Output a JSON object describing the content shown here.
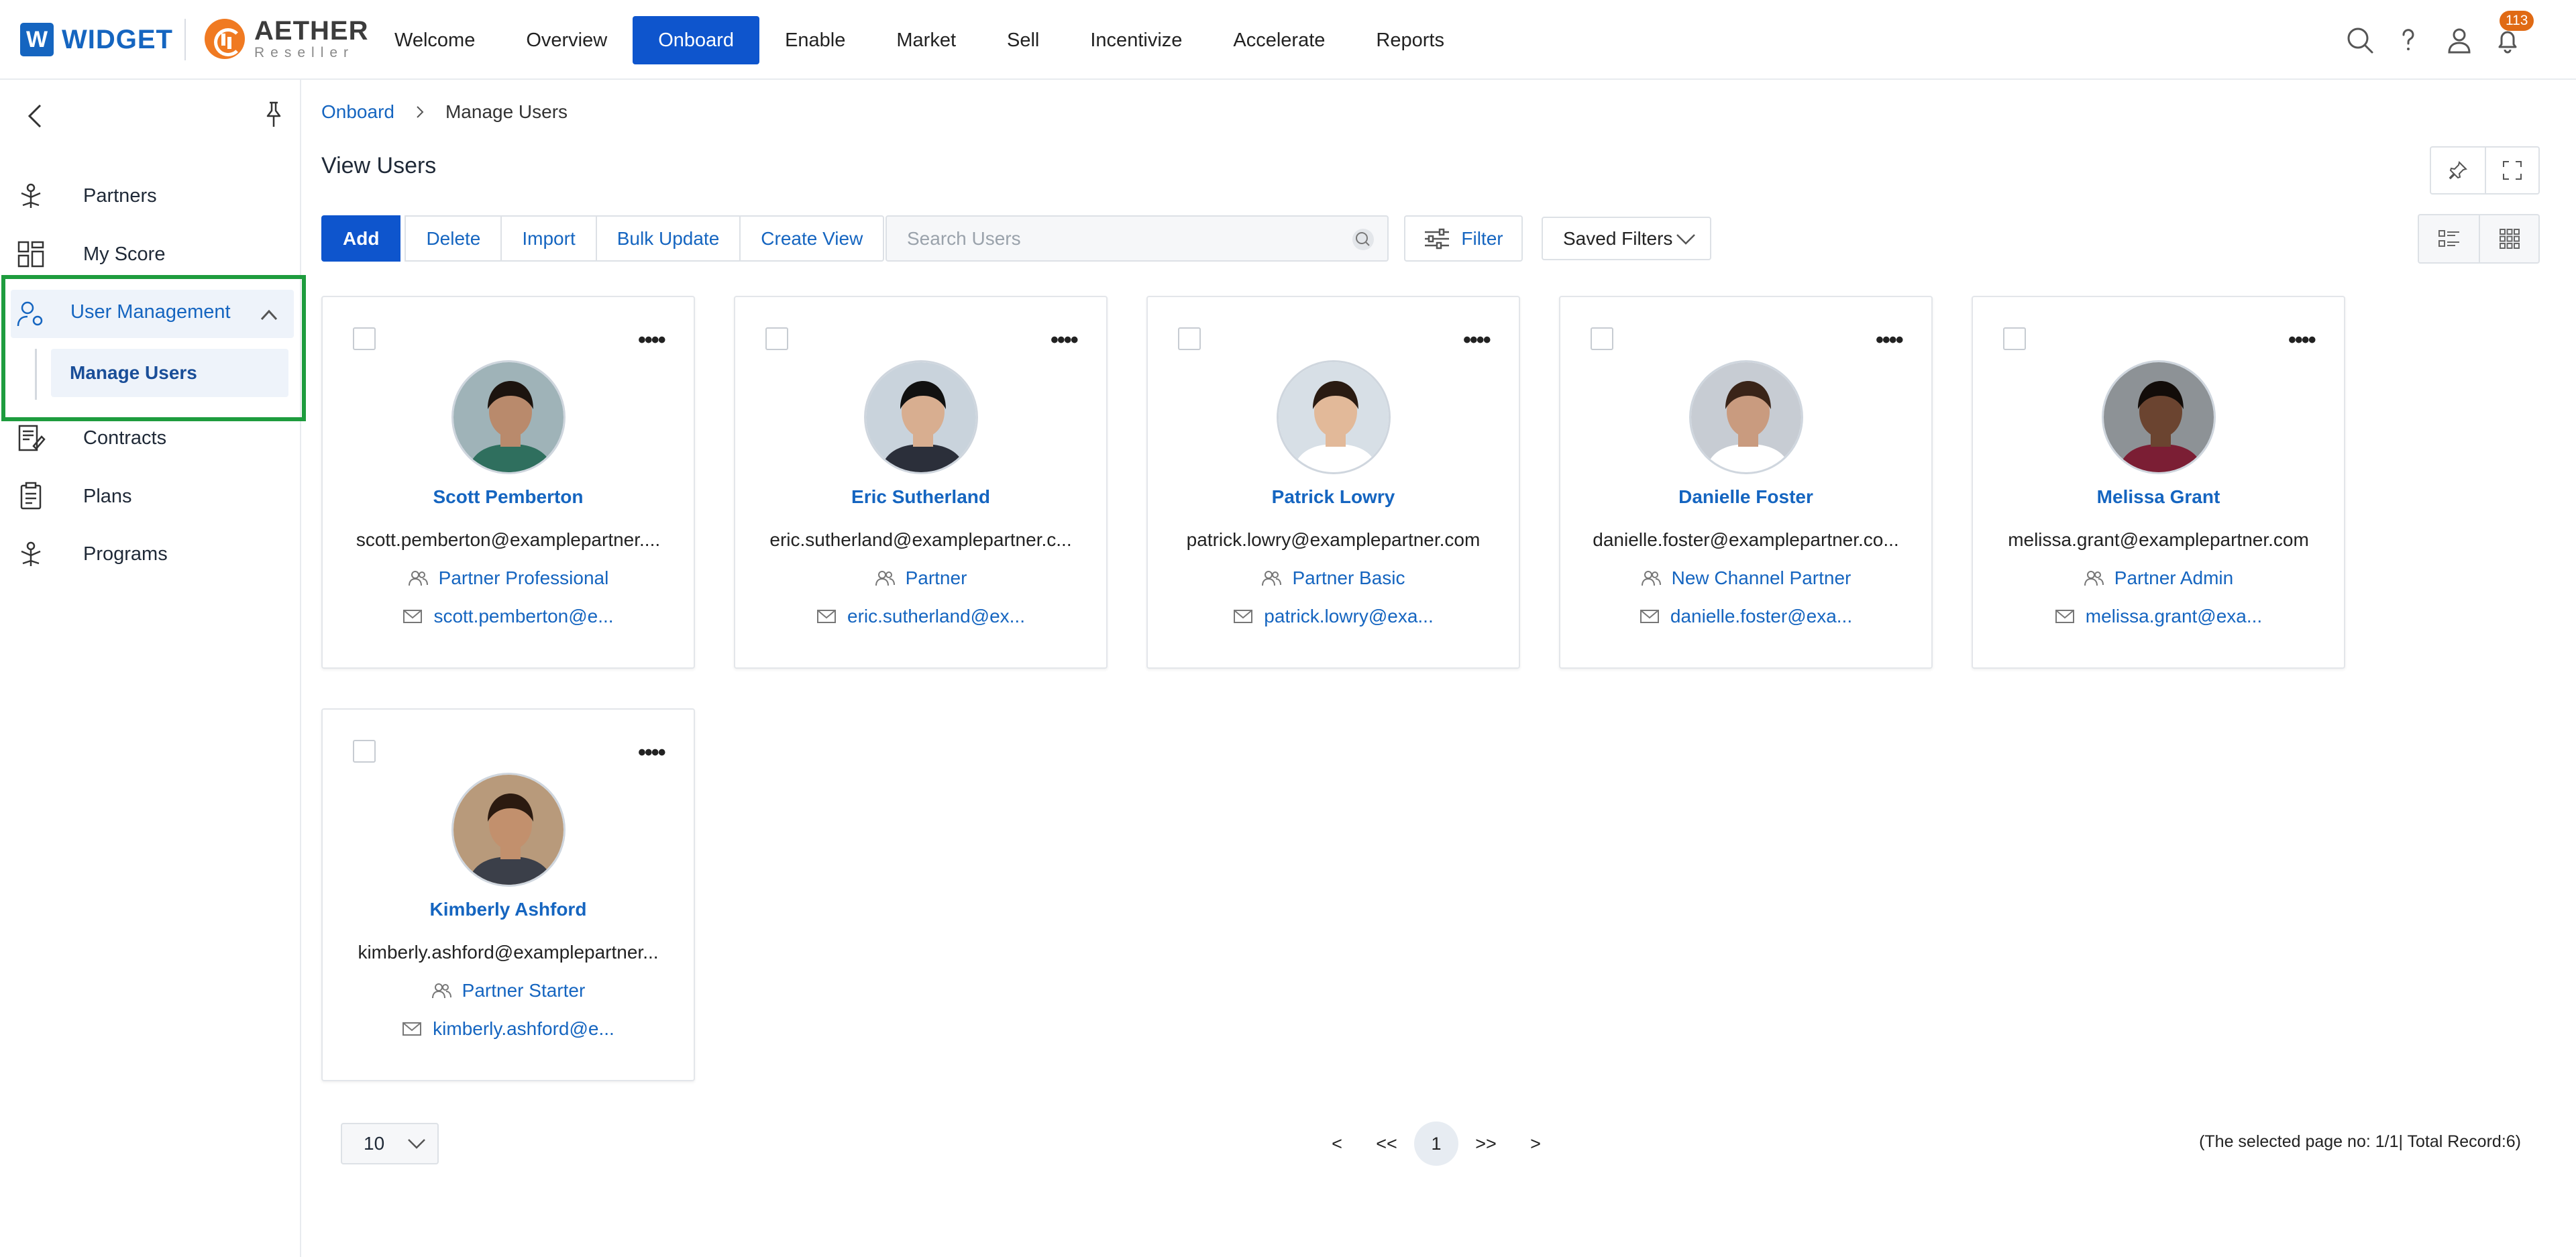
{
  "brand": {
    "widget_badge": "W",
    "widget": "WIDGET",
    "aether": "AETHER",
    "aether_sub": "Reseller"
  },
  "nav": [
    {
      "label": "Welcome",
      "active": false
    },
    {
      "label": "Overview",
      "active": false
    },
    {
      "label": "Onboard",
      "active": true
    },
    {
      "label": "Enable",
      "active": false
    },
    {
      "label": "Market",
      "active": false
    },
    {
      "label": "Sell",
      "active": false
    },
    {
      "label": "Incentivize",
      "active": false
    },
    {
      "label": "Accelerate",
      "active": false
    },
    {
      "label": "Reports",
      "active": false
    }
  ],
  "top_icons": [
    "search-icon",
    "help-icon",
    "user-icon",
    "bell-icon"
  ],
  "notifications": {
    "count": "113",
    "color": "#e06a14"
  },
  "accent_color": "#0e55cd",
  "sidebar": {
    "items": [
      {
        "label": "Partners",
        "icon": "partners-icon"
      },
      {
        "label": "My Score",
        "icon": "dashboard-icon"
      },
      {
        "label": "User Management",
        "icon": "user-settings-icon"
      },
      {
        "label": "Contracts",
        "icon": "contract-icon"
      },
      {
        "label": "Plans",
        "icon": "clipboard-icon"
      },
      {
        "label": "Programs",
        "icon": "programs-icon"
      }
    ],
    "sub_item": "Manage Users",
    "highlight_color": "#1e9c3e"
  },
  "breadcrumb": {
    "parent": "Onboard",
    "current": "Manage Users"
  },
  "page_title": "View Users",
  "toolbar": {
    "add": "Add",
    "delete": "Delete",
    "import": "Import",
    "bulk_update": "Bulk Update",
    "create_view": "Create View",
    "search_placeholder": "Search Users",
    "filter": "Filter",
    "saved_filters": "Saved Filters"
  },
  "users": [
    {
      "name": "Scott Pemberton",
      "email": "scott.pemberton@examplepartner....",
      "role": "Partner Professional",
      "mail": "scott.pemberton@e..."
    },
    {
      "name": "Eric Sutherland",
      "email": "eric.sutherland@examplepartner.c...",
      "role": "Partner",
      "mail": "eric.sutherland@ex..."
    },
    {
      "name": "Patrick Lowry",
      "email": "patrick.lowry@examplepartner.com",
      "role": "Partner Basic",
      "mail": "patrick.lowry@exa..."
    },
    {
      "name": "Danielle Foster",
      "email": "danielle.foster@examplepartner.co...",
      "role": "New Channel Partner",
      "mail": "danielle.foster@exa..."
    },
    {
      "name": "Melissa Grant",
      "email": "melissa.grant@examplepartner.com",
      "role": "Partner Admin",
      "mail": "melissa.grant@exa..."
    },
    {
      "name": "Kimberly Ashford",
      "email": "kimberly.ashford@examplepartner...",
      "role": "Partner Starter",
      "mail": "kimberly.ashford@e..."
    }
  ],
  "pagination": {
    "per_page": "10",
    "prev": "<",
    "first": "<<",
    "current": "1",
    "last": ">>",
    "next": ">",
    "info": "(The selected page no: 1/1| Total Record:6)"
  }
}
